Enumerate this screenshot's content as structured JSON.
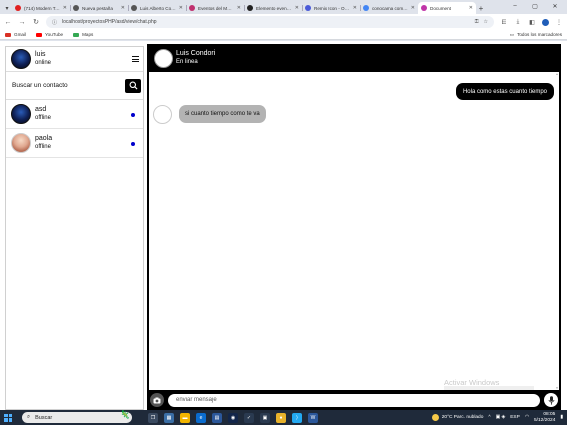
{
  "browser": {
    "tabs": [
      {
        "title": "(714) Modern Tol...",
        "fav_color": "#e02020",
        "active": false
      },
      {
        "title": "Nueva pestaña",
        "fav_color": "#555555",
        "active": false
      },
      {
        "title": "Luis Alberto Cond...",
        "fav_color": "#555555",
        "active": false
      },
      {
        "title": "Eventos del Mous...",
        "fav_color": "#c0306e",
        "active": false
      },
      {
        "title": "Elemento eventos...",
        "fav_color": "#222222",
        "active": false
      },
      {
        "title": "Remix Icon - Ope...",
        "fav_color": "#4a5ad8",
        "active": false
      },
      {
        "title": "conocama comp...",
        "fav_color": "#4285f4",
        "active": false
      },
      {
        "title": "Document",
        "fav_color": "#c035a8",
        "active": true
      }
    ],
    "url": "localhost/proyectosPHP/asd/view/chat.php",
    "bookmarks": [
      {
        "label": "Gmail",
        "color": "#d93025"
      },
      {
        "label": "YouTube",
        "color": "#ff0000"
      },
      {
        "label": "Maps",
        "color": "#34a853"
      }
    ],
    "all_bookmarks": "Todos los marcadores"
  },
  "sidebar": {
    "user": {
      "name": "luis",
      "status": "online"
    },
    "search": {
      "placeholder": "Buscar un contacto"
    },
    "contacts": [
      {
        "name": "asd",
        "status": "offline",
        "online_dot": true
      },
      {
        "name": "paola",
        "status": "offline",
        "online_dot": true
      }
    ]
  },
  "chat": {
    "header": {
      "name": "Luis Condori",
      "status": "En linea"
    },
    "messages": [
      {
        "direction": "out",
        "text": "Hola como estas cuanto tiempo"
      },
      {
        "direction": "in",
        "text": "si cuanto tiempo como te va"
      }
    ],
    "input": {
      "placeholder": "enviar mensaje"
    },
    "watermark": "Activar Windows"
  },
  "taskbar": {
    "search_label": "Buscar",
    "weather": "20°C  Parc. nublado",
    "language": "ESP",
    "time": "08:05",
    "date": "5/12/2024"
  },
  "colors": {
    "accent": "#000000",
    "online_dot": "#0000cc",
    "incoming_bubble": "#b3b3b3"
  }
}
